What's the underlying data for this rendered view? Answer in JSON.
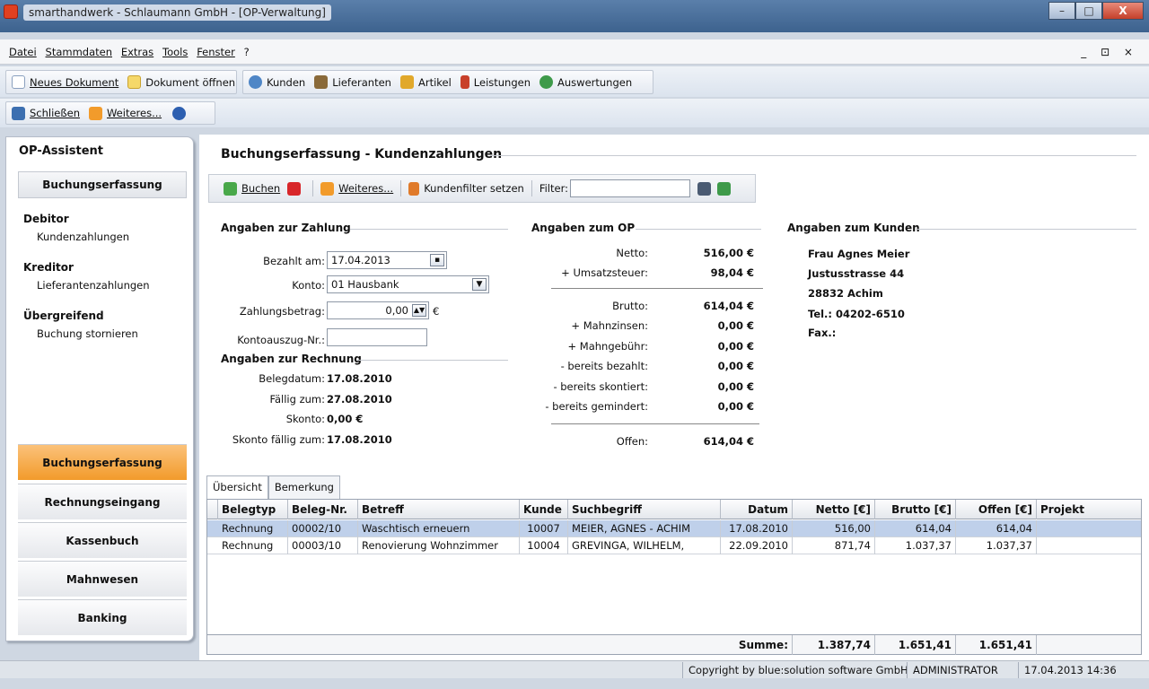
{
  "window": {
    "title": "smarthandwerk - Schlaumann GmbH - [OP-Verwaltung]",
    "minimize": "–",
    "maximize": "□",
    "close": "X"
  },
  "menu": {
    "items": [
      "Datei",
      "Stammdaten",
      "Extras",
      "Tools",
      "Fenster",
      "?"
    ],
    "mdi_controls": "_ ⊡ ×"
  },
  "toolbar1": {
    "new_doc": "Neues Dokument",
    "open_doc": "Dokument öffnen",
    "customers": "Kunden",
    "suppliers": "Lieferanten",
    "articles": "Artikel",
    "services": "Leistungen",
    "reports": "Auswertungen"
  },
  "toolbar2": {
    "close": "Schließen",
    "more": "Weiteres..."
  },
  "sidebar": {
    "title": "OP-Assistent",
    "section": "Buchungserfassung",
    "groups": [
      {
        "heading": "Debitor",
        "link": "Kundenzahlungen"
      },
      {
        "heading": "Kreditor",
        "link": "Lieferantenzahlungen"
      },
      {
        "heading": "Übergreifend",
        "link": "Buchung stornieren"
      }
    ],
    "nav": [
      "Buchungserfassung",
      "Rechnungseingang",
      "Kassenbuch",
      "Mahnwesen",
      "Banking"
    ]
  },
  "main": {
    "title": "Buchungserfassung - Kundenzahlungen",
    "toolbar": {
      "book": "Buchen",
      "more": "Weiteres...",
      "filter_btn": "Kundenfilter setzen",
      "filter_label": "Filter:",
      "filter_value": ""
    },
    "payment": {
      "heading": "Angaben zur Zahlung",
      "paid_on_label": "Bezahlt am:",
      "paid_on": "17.04.2013",
      "account_label": "Konto:",
      "account": "01 Hausbank",
      "amount_label": "Zahlungsbetrag:",
      "amount": "0,00",
      "currency": "€",
      "statement_label": "Kontoauszug-Nr.:",
      "statement": ""
    },
    "invoice": {
      "heading": "Angaben zur Rechnung",
      "rows": [
        {
          "label": "Belegdatum:",
          "value": "17.08.2010"
        },
        {
          "label": "Fällig zum:",
          "value": "27.08.2010"
        },
        {
          "label": "Skonto:",
          "value": "0,00 €"
        },
        {
          "label": "Skonto fällig zum:",
          "value": "17.08.2010"
        }
      ]
    },
    "op": {
      "heading": "Angaben zum OP",
      "rows": [
        {
          "label": "Netto:",
          "value": "516,00 €"
        },
        {
          "label": "+ Umsatzsteuer:",
          "value": "98,04 €"
        },
        {
          "label": "Brutto:",
          "value": "614,04 €"
        },
        {
          "label": "+ Mahnzinsen:",
          "value": "0,00 €"
        },
        {
          "label": "+ Mahngebühr:",
          "value": "0,00 €"
        },
        {
          "label": "- bereits bezahlt:",
          "value": "0,00 €"
        },
        {
          "label": "- bereits skontiert:",
          "value": "0,00 €"
        },
        {
          "label": "- bereits gemindert:",
          "value": "0,00 €"
        },
        {
          "label": "Offen:",
          "value": "614,04 €"
        }
      ]
    },
    "customer": {
      "heading": "Angaben zum Kunden",
      "lines": [
        "Frau Agnes Meier",
        "Justusstrasse 44",
        "28832 Achim",
        "Tel.: 04202-6510",
        "Fax.:"
      ]
    },
    "tabs": [
      "Übersicht",
      "Bemerkung"
    ],
    "grid": {
      "headers": [
        "Belegtyp",
        "Beleg-Nr.",
        "Betreff",
        "Kunde",
        "Suchbegriff",
        "Datum",
        "Netto [€]",
        "Brutto [€]",
        "Offen [€]",
        "Projekt"
      ],
      "rows": [
        [
          "Rechnung",
          "00002/10",
          "Waschtisch erneuern",
          "10007",
          "MEIER, AGNES - ACHIM",
          "17.08.2010",
          "516,00",
          "614,04",
          "614,04",
          ""
        ],
        [
          "Rechnung",
          "00003/10",
          "Renovierung Wohnzimmer",
          "10004",
          "GREVINGA, WILHELM,",
          "22.09.2010",
          "871,74",
          "1.037,37",
          "1.037,37",
          ""
        ]
      ],
      "sum_label": "Summe:",
      "sum_netto": "1.387,74",
      "sum_brutto": "1.651,41",
      "sum_offen": "1.651,41"
    }
  },
  "status": {
    "copyright": "Copyright by blue:solution software GmbH",
    "user": "ADMINISTRATOR",
    "datetime": "17.04.2013 14:36"
  }
}
